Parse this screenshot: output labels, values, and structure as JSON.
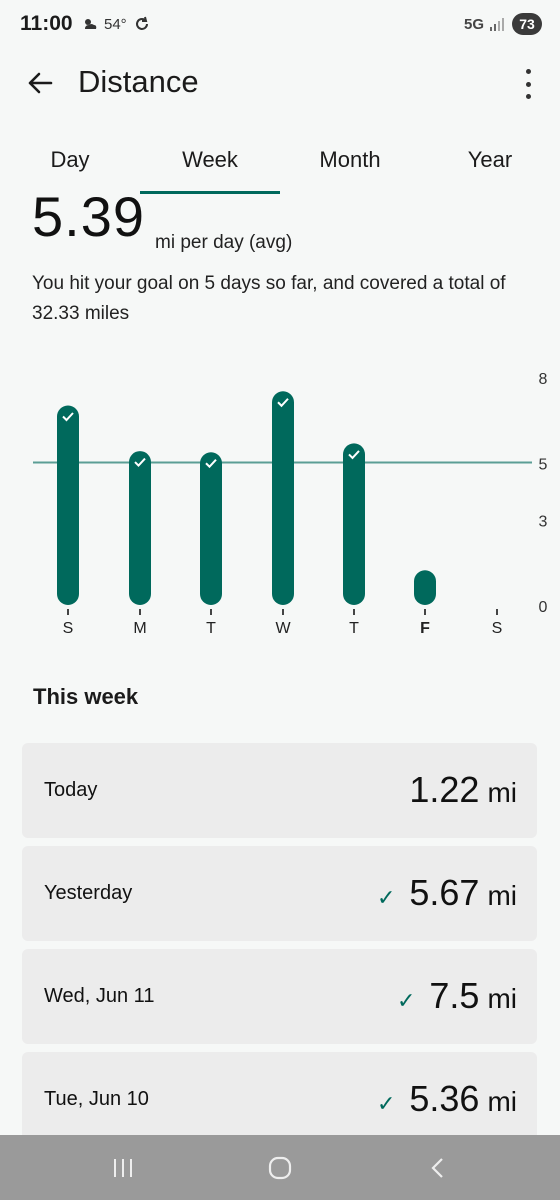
{
  "status": {
    "time": "11:00",
    "temp": "54°",
    "network": "5G",
    "battery": "73"
  },
  "header": {
    "title": "Distance"
  },
  "tabs": [
    {
      "label": "Day"
    },
    {
      "label": "Week"
    },
    {
      "label": "Month"
    },
    {
      "label": "Year"
    }
  ],
  "summary": {
    "value": "5.39",
    "unit_label": "mi per day (avg)",
    "description": "You hit your goal on 5 days so far, and covered a total of 32.33 miles"
  },
  "colors": {
    "accent": "#00695c",
    "goal_line": "#5b9e95",
    "card_bg": "#ececec"
  },
  "chart_data": {
    "type": "bar",
    "categories": [
      "S",
      "M",
      "T",
      "W",
      "T",
      "F",
      "S"
    ],
    "values": [
      7.0,
      5.4,
      5.36,
      7.5,
      5.67,
      1.22,
      0
    ],
    "goal_met": [
      true,
      true,
      true,
      true,
      true,
      false,
      false
    ],
    "current_day_index": 5,
    "goal": 5,
    "yticks": [
      "8",
      "5",
      "3",
      "0"
    ],
    "ylim": [
      0,
      8
    ]
  },
  "section": {
    "title": "This week"
  },
  "days": [
    {
      "label": "Today",
      "value": "1.22",
      "unit": "mi",
      "goal_met": false
    },
    {
      "label": "Yesterday",
      "value": "5.67",
      "unit": "mi",
      "goal_met": true
    },
    {
      "label": "Wed, Jun 11",
      "value": "7.5",
      "unit": "mi",
      "goal_met": true
    },
    {
      "label": "Tue, Jun 10",
      "value": "5.36",
      "unit": "mi",
      "goal_met": true
    }
  ],
  "navbar": {
    "icons": [
      "recent-apps-icon",
      "home-icon",
      "back-nav-icon"
    ]
  }
}
